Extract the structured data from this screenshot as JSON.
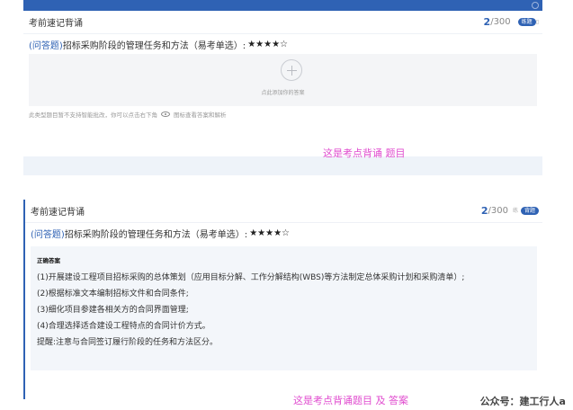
{
  "card1": {
    "title": "考前速记背诵",
    "progress_current": "2",
    "progress_total": "/300",
    "pill_label": "练题",
    "pill_side": "▯",
    "question_tag": "(问答题)",
    "question_text": "招标采购阶段的管理任务和方法（易考单选）:",
    "question_stars": "★★★★☆",
    "add_text": "点此添加你的答案",
    "hint_text": "此类型题目暂不支持智能批改，你可以点击右下角",
    "hint_text_2": "图标查看答案和解析",
    "note": "这是考点背诵 题目"
  },
  "card2": {
    "title": "考前速记背诵",
    "progress_current": "2",
    "progress_total": "/300",
    "pill_light": "练",
    "pill_label": "背题",
    "question_tag": "(问答题)",
    "question_text": "招标采购阶段的管理任务和方法（易考单选）:",
    "question_stars": "★★★★☆",
    "answer_title": "正确答案",
    "answer_lines": [
      "(1)开展建设工程项目招标采购的总体策划（应用目标分解、工作分解结构(WBS)等方法制定总体采购计划和采购清单）;",
      "(2)根据标准文本编制招标文件和合同条件;",
      "(3)细化项目参建各相关方的合同界面管理;",
      "(4)合理选择适合建设工程特点的合同计价方式。",
      "提醒:注意与合同签订履行阶段的任务和方法区分。"
    ],
    "note": "这是考点背诵题目 及 答案"
  },
  "footer": "公众号：建工行人a"
}
